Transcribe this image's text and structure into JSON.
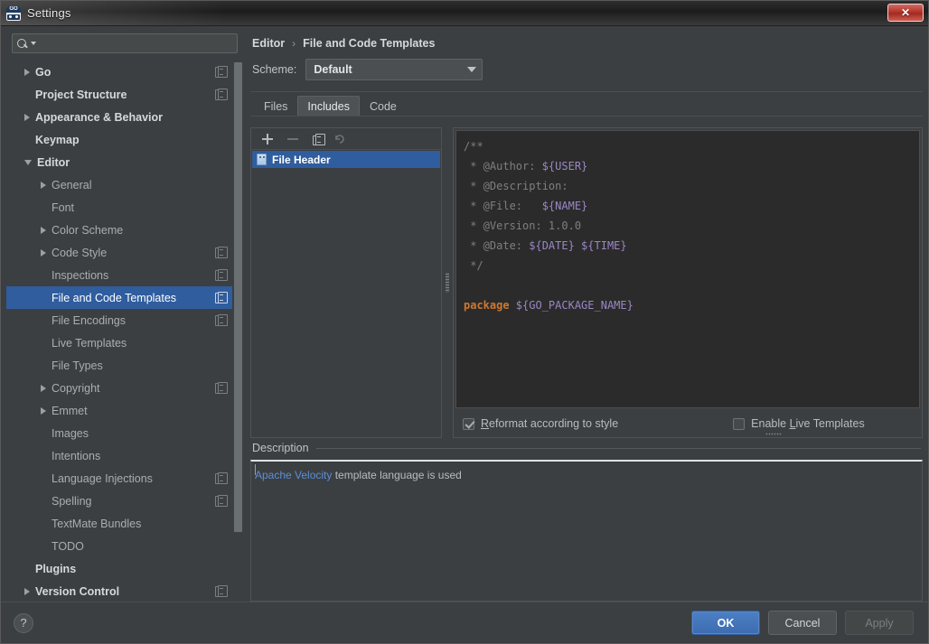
{
  "window": {
    "title": "Settings",
    "app_icon": "goland-go-icon",
    "close_label": "✕"
  },
  "search": {
    "value": "",
    "placeholder": "",
    "icon": "search-icon"
  },
  "sidebar": {
    "items": [
      {
        "label": "Go",
        "level": 0,
        "arrow": "right",
        "copy": true,
        "selected": false
      },
      {
        "label": "Project Structure",
        "level": 0,
        "arrow": "none",
        "copy": true,
        "selected": false
      },
      {
        "label": "Appearance & Behavior",
        "level": 0,
        "arrow": "right",
        "copy": false,
        "selected": false
      },
      {
        "label": "Keymap",
        "level": 0,
        "arrow": "none",
        "copy": false,
        "selected": false
      },
      {
        "label": "Editor",
        "level": 0,
        "arrow": "down",
        "copy": false,
        "selected": false
      },
      {
        "label": "General",
        "level": 1,
        "arrow": "right",
        "copy": false,
        "selected": false
      },
      {
        "label": "Font",
        "level": 1,
        "arrow": "none",
        "copy": false,
        "selected": false
      },
      {
        "label": "Color Scheme",
        "level": 1,
        "arrow": "right",
        "copy": false,
        "selected": false
      },
      {
        "label": "Code Style",
        "level": 1,
        "arrow": "right",
        "copy": true,
        "selected": false
      },
      {
        "label": "Inspections",
        "level": 1,
        "arrow": "none",
        "copy": true,
        "selected": false
      },
      {
        "label": "File and Code Templates",
        "level": 1,
        "arrow": "none",
        "copy": true,
        "selected": true
      },
      {
        "label": "File Encodings",
        "level": 1,
        "arrow": "none",
        "copy": true,
        "selected": false
      },
      {
        "label": "Live Templates",
        "level": 1,
        "arrow": "none",
        "copy": false,
        "selected": false
      },
      {
        "label": "File Types",
        "level": 1,
        "arrow": "none",
        "copy": false,
        "selected": false
      },
      {
        "label": "Copyright",
        "level": 1,
        "arrow": "right",
        "copy": true,
        "selected": false
      },
      {
        "label": "Emmet",
        "level": 1,
        "arrow": "right",
        "copy": false,
        "selected": false
      },
      {
        "label": "Images",
        "level": 1,
        "arrow": "none",
        "copy": false,
        "selected": false
      },
      {
        "label": "Intentions",
        "level": 1,
        "arrow": "none",
        "copy": false,
        "selected": false
      },
      {
        "label": "Language Injections",
        "level": 1,
        "arrow": "none",
        "copy": true,
        "selected": false
      },
      {
        "label": "Spelling",
        "level": 1,
        "arrow": "none",
        "copy": true,
        "selected": false
      },
      {
        "label": "TextMate Bundles",
        "level": 1,
        "arrow": "none",
        "copy": false,
        "selected": false
      },
      {
        "label": "TODO",
        "level": 1,
        "arrow": "none",
        "copy": false,
        "selected": false
      },
      {
        "label": "Plugins",
        "level": 0,
        "arrow": "none",
        "copy": false,
        "selected": false
      },
      {
        "label": "Version Control",
        "level": 0,
        "arrow": "right",
        "copy": true,
        "selected": false
      }
    ]
  },
  "breadcrumb": {
    "parent": "Editor",
    "separator": "›",
    "current": "File and Code Templates"
  },
  "scheme": {
    "label": "Scheme:",
    "value": "Default"
  },
  "tabs": [
    {
      "label": "Files",
      "active": false
    },
    {
      "label": "Includes",
      "active": true
    },
    {
      "label": "Code",
      "active": false
    }
  ],
  "list_toolbar": {
    "add": {
      "name": "add-template-button",
      "glyph": "+",
      "enabled": true
    },
    "remove": {
      "name": "remove-template-button",
      "glyph": "−",
      "enabled": false
    },
    "copy": {
      "name": "copy-template-button",
      "glyph": "copy",
      "enabled": true
    },
    "reset": {
      "name": "reset-template-button",
      "glyph": "↺",
      "enabled": false
    }
  },
  "template_list": {
    "items": [
      {
        "label": "File Header",
        "selected": true
      }
    ]
  },
  "editor": {
    "lines": [
      [
        {
          "t": "/**",
          "c": "comment"
        }
      ],
      [
        {
          "t": " * @Author: ",
          "c": "comment"
        },
        {
          "t": "${USER}",
          "c": "var"
        }
      ],
      [
        {
          "t": " * @Description:",
          "c": "comment"
        }
      ],
      [
        {
          "t": " * @File:   ",
          "c": "comment"
        },
        {
          "t": "${NAME}",
          "c": "var"
        }
      ],
      [
        {
          "t": " * @Version: 1.0.0",
          "c": "comment"
        }
      ],
      [
        {
          "t": " * @Date: ",
          "c": "comment"
        },
        {
          "t": "${DATE} ${TIME}",
          "c": "var"
        }
      ],
      [
        {
          "t": " */",
          "c": "comment"
        }
      ],
      [
        {
          "t": "",
          "c": "comment"
        }
      ],
      [
        {
          "t": "package ",
          "c": "kw"
        },
        {
          "t": "${GO_PACKAGE_NAME}",
          "c": "var"
        }
      ]
    ]
  },
  "options": {
    "reformat": {
      "label_pre": "",
      "mnemonic": "R",
      "label_post": "eformat according to style",
      "checked": true
    },
    "live": {
      "label_pre": "Enable ",
      "mnemonic": "L",
      "label_post": "ive Templates",
      "checked": false
    }
  },
  "description": {
    "legend": "Description",
    "link_text": "Apache Velocity",
    "rest_text": " template language is used"
  },
  "footer": {
    "help": "?",
    "ok": "OK",
    "cancel": "Cancel",
    "apply": "Apply"
  },
  "colors": {
    "accent_selection": "#2f5d9e",
    "panel_bg": "#3c3f41",
    "editor_bg": "#2b2b2b",
    "keyword": "#cc7832",
    "variable": "#9b87c4",
    "link": "#5a8fd6",
    "close_red": "#b5342b"
  }
}
